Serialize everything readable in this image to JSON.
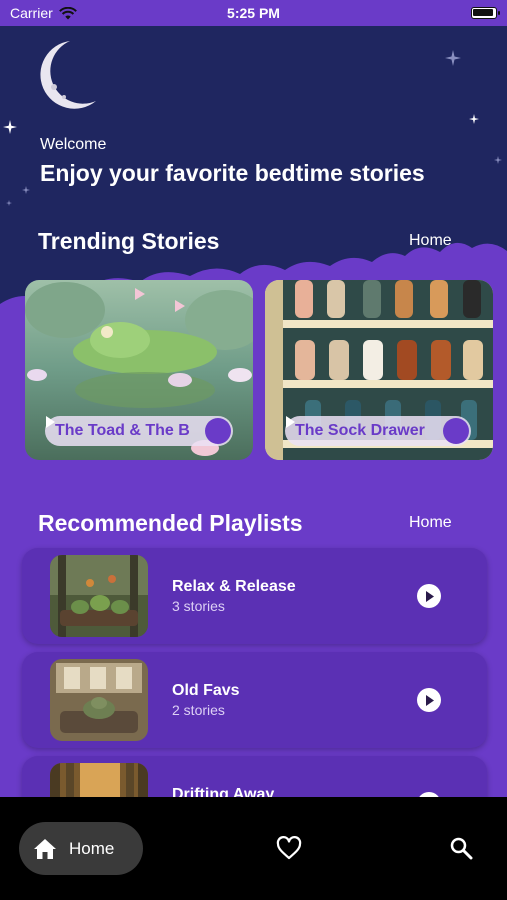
{
  "status_bar": {
    "carrier": "Carrier",
    "time": "5:25 PM"
  },
  "header": {
    "welcome": "Welcome",
    "headline": "Enjoy your favorite bedtime stories",
    "icons": [
      "crescent-moon-icon",
      "star-icon"
    ]
  },
  "trending": {
    "title": "Trending Stories",
    "link": "Home",
    "cards": [
      {
        "title": "The Toad & The B",
        "icon": "play-icon"
      },
      {
        "title": "The Sock Drawer",
        "icon": "play-icon"
      }
    ]
  },
  "playlists": {
    "title": "Recommended Playlists",
    "link": "Home",
    "items": [
      {
        "title": "Relax & Release",
        "count": "3 stories",
        "icon": "play-icon"
      },
      {
        "title": "Old Favs",
        "count": "2 stories",
        "icon": "play-icon"
      },
      {
        "title": "Drifting Away",
        "icon": "play-icon"
      }
    ]
  },
  "tab_bar": {
    "home_label": "Home",
    "icons": [
      "home-icon",
      "heart-icon",
      "search-icon"
    ]
  },
  "colors": {
    "background": "#6a3bc8",
    "sky": "#1f2660",
    "card_row": "#5b30b4",
    "tab_bar": "#000000"
  }
}
